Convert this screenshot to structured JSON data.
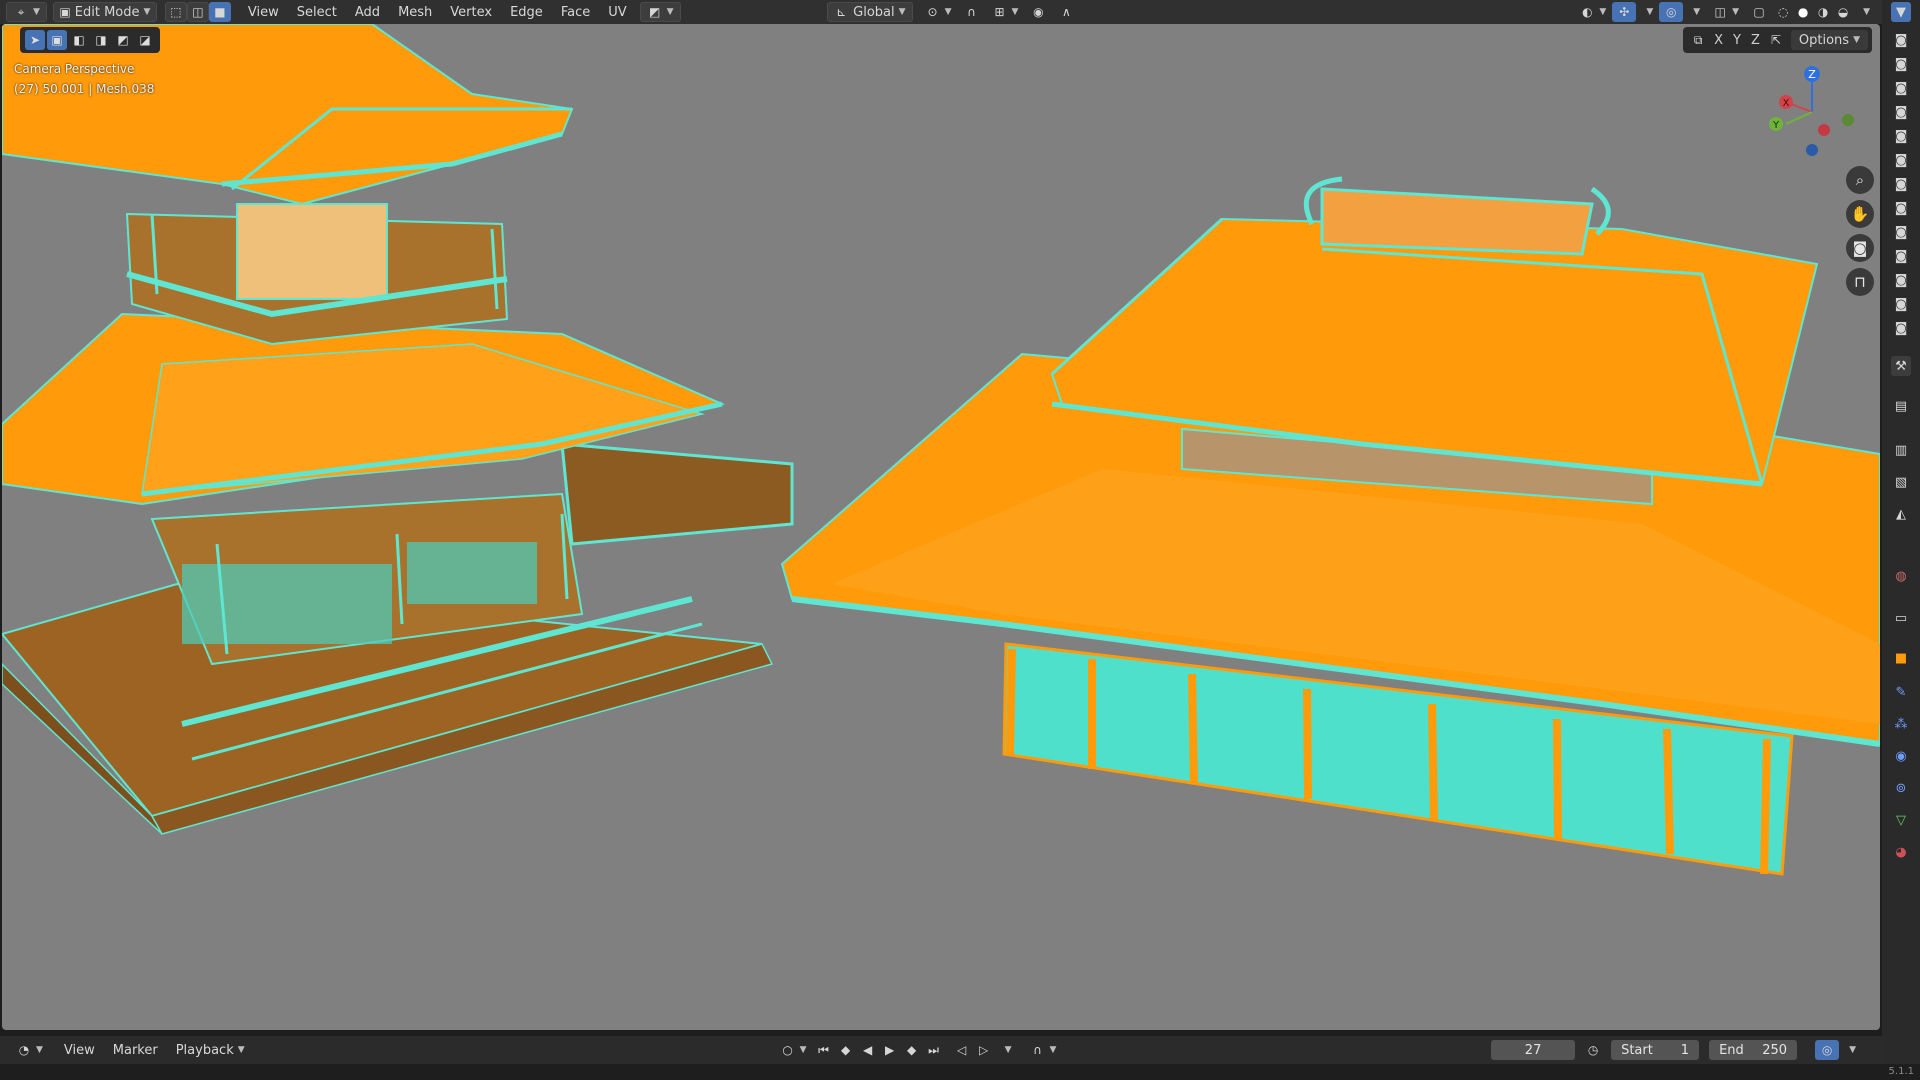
{
  "header": {
    "mode": "Edit Mode",
    "menus": [
      "View",
      "Select",
      "Add",
      "Mesh",
      "Vertex",
      "Edge",
      "Face",
      "UV"
    ],
    "transform_orientation": "Global"
  },
  "viewport": {
    "camera_label": "Camera Perspective",
    "object_info": "(27) 50.001 | Mesh.038",
    "axis_x": "X",
    "axis_y": "Y",
    "axis_z": "Z",
    "options_label": "Options",
    "colors": {
      "roof": "#ff9a0a",
      "wire": "#5fe6d2",
      "background": "#808080"
    }
  },
  "timeline": {
    "menus": [
      "View",
      "Marker",
      "Playback"
    ],
    "current_frame": "27",
    "start_label": "Start",
    "start_value": "1",
    "end_label": "End",
    "end_value": "250"
  },
  "status": {
    "version": "5.1.1"
  }
}
